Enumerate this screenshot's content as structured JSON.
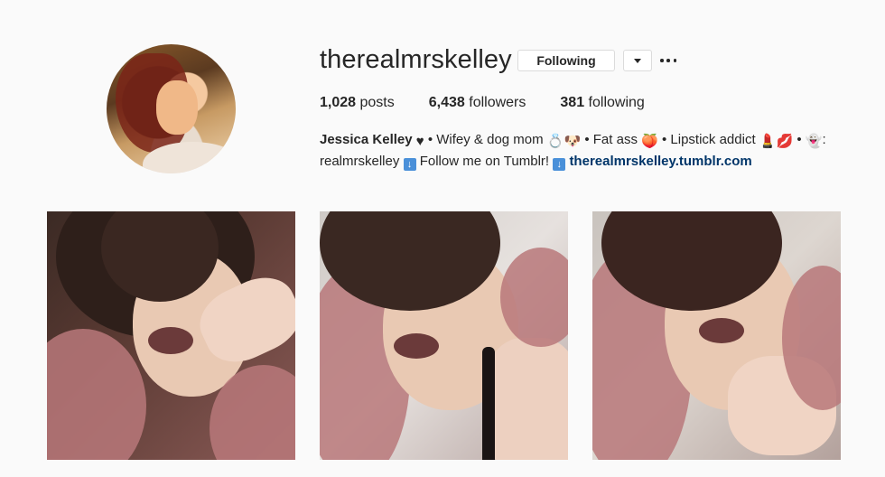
{
  "profile": {
    "username": "therealmrskelley",
    "following_label": "Following",
    "stats": {
      "posts_count": "1,028",
      "posts_label": "posts",
      "followers_count": "6,438",
      "followers_label": "followers",
      "following_count": "381",
      "following_label": "following"
    },
    "bio": {
      "name": "Jessica Kelley",
      "line1": "• Wifey & dog mom",
      "line1b": "• Fat ass",
      "line1c": "• Lipstick addict",
      "line1d": "•",
      "line1e": ":",
      "line2": "realmrskelley",
      "line2b": "Follow me on Tumblr!",
      "link": "therealmrskelley.tumblr.com"
    }
  },
  "icons": {
    "heart": "black-heart-icon",
    "ring_dog": "ring-dog-emoji",
    "peach": "peach-emoji",
    "lipstick_kiss": "lipstick-kiss-emoji",
    "ghost": "ghost-emoji",
    "down_arrow": "down-arrow-box-icon"
  },
  "colors": {
    "link": "#003569",
    "background": "#fafafa",
    "border": "#dbdbdb"
  }
}
